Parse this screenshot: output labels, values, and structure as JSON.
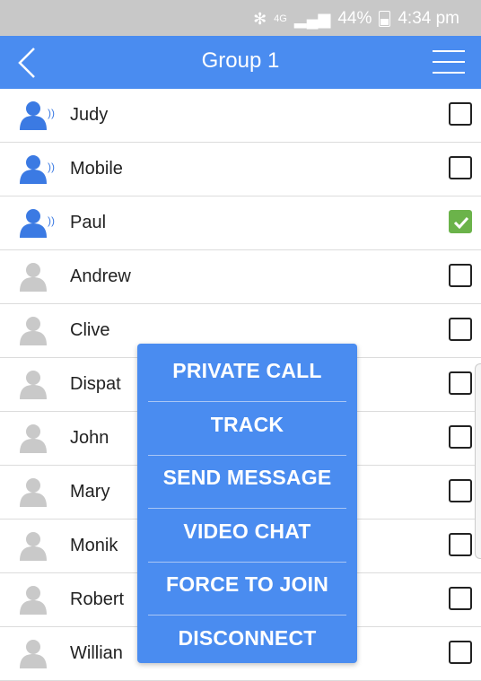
{
  "status_bar": {
    "network": "4G",
    "battery": "44%",
    "time": "4:34 pm"
  },
  "header": {
    "title": "Group 1"
  },
  "contacts": [
    {
      "name": "Judy",
      "avatar": "speaker-avatar",
      "checked": false
    },
    {
      "name": "Mobile",
      "avatar": "speaker-avatar",
      "checked": false
    },
    {
      "name": "Paul",
      "avatar": "speaker-avatar",
      "checked": true
    },
    {
      "name": "Andrew",
      "avatar": "grey-avatar",
      "checked": false
    },
    {
      "name": "Clive",
      "avatar": "grey-avatar",
      "checked": false
    },
    {
      "name": "Dispat",
      "avatar": "grey-avatar",
      "checked": false
    },
    {
      "name": "John",
      "avatar": "grey-avatar",
      "checked": false
    },
    {
      "name": "Mary",
      "avatar": "grey-avatar",
      "checked": false
    },
    {
      "name": "Monik",
      "avatar": "grey-avatar",
      "checked": false
    },
    {
      "name": "Robert",
      "avatar": "grey-avatar",
      "checked": false
    },
    {
      "name": "Willian",
      "avatar": "grey-avatar",
      "checked": false
    }
  ],
  "popup_menu": {
    "items": [
      "PRIVATE CALL",
      "TRACK",
      "SEND MESSAGE",
      "VIDEO CHAT",
      "FORCE TO JOIN",
      "DISCONNECT"
    ]
  },
  "colors": {
    "accent": "#4a8cf0",
    "checked": "#6bb34a",
    "status_bar": "#c8c8c8"
  }
}
